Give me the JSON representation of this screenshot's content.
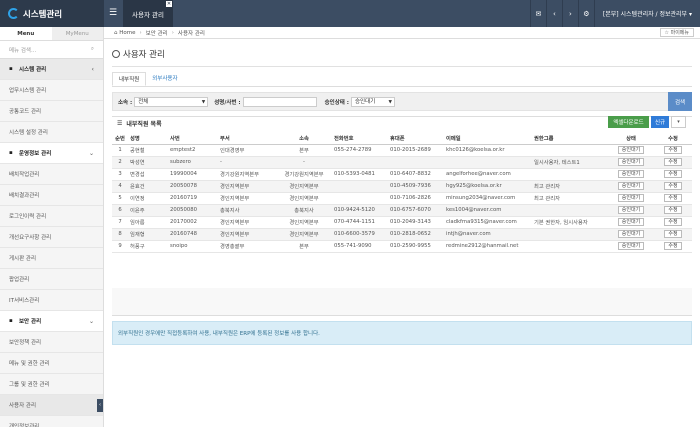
{
  "app": {
    "title": "시스템관리"
  },
  "topbar": {
    "active_tab": "사용자 관리",
    "user_label": "[본부] 시스템관리자 / 정보관리부 ▾"
  },
  "sidebar": {
    "tabs": [
      "Menu",
      "MyMenu"
    ],
    "search_placeholder": "메뉴 검색...",
    "items": [
      {
        "label": "시스템 관리",
        "type": "group"
      },
      {
        "label": "업무시스템 관리",
        "type": "item"
      },
      {
        "label": "공통코드 관리",
        "type": "item"
      },
      {
        "label": "시스템 설정 관리",
        "type": "item"
      },
      {
        "label": "운영정보 관리",
        "type": "group-open"
      },
      {
        "label": "배치작업관리",
        "type": "item"
      },
      {
        "label": "배치결과관리",
        "type": "item"
      },
      {
        "label": "로그인이력 관리",
        "type": "item"
      },
      {
        "label": "개선요구사항 관리",
        "type": "item"
      },
      {
        "label": "게시판 관리",
        "type": "item"
      },
      {
        "label": "팝업관리",
        "type": "item"
      },
      {
        "label": "IT서비스관리",
        "type": "item"
      },
      {
        "label": "보안 관리",
        "type": "group-open"
      },
      {
        "label": "보안정책 관리",
        "type": "item"
      },
      {
        "label": "메뉴 및 권한 관리",
        "type": "item"
      },
      {
        "label": "그룹 및 권한 관리",
        "type": "item"
      },
      {
        "label": "사용자 관리",
        "type": "active"
      },
      {
        "label": "개인정보관리",
        "type": "item"
      }
    ]
  },
  "breadcrumb": {
    "home": "Home",
    "level1": "보안 관리",
    "level2": "사용자 관리",
    "favorite": "☆ 마이메뉴"
  },
  "page": {
    "title": "사용자 관리",
    "tabs": [
      "내부직원",
      "외부사용자"
    ]
  },
  "filter": {
    "org_label": "소속 :",
    "org_value": "전체",
    "name_label": "성명/사번 :",
    "status_label": "승인상태 :",
    "status_value": "승인대기",
    "search_button": "검색"
  },
  "list": {
    "title": "내부직원 목록",
    "excel_button": "엑셀다운로드",
    "new_button": "신규",
    "columns": [
      "순번",
      "성명",
      "사번",
      "부서",
      "소속",
      "전화번호",
      "휴대폰",
      "이메일",
      "권한그룹",
      "상태",
      "수정"
    ],
    "rows": [
      [
        "1",
        "공현철",
        "emptest2",
        "인대경영부",
        "본부",
        "055-274-2789",
        "010-2015-2689",
        "khc0126@koelsa.or.kr",
        "",
        "승인대기",
        "수정"
      ],
      [
        "2",
        "박성연",
        "subzero",
        "-",
        "-",
        "",
        "",
        "",
        "일시사용자, 테스트1",
        "승인대기",
        "수정"
      ],
      [
        "3",
        "변경섭",
        "19990004",
        "경기강원지역본부",
        "경기강원지역본부",
        "010-5393-0481",
        "010-6407-8832",
        "angelforhee@naver.com",
        "",
        "승인대기",
        "수정"
      ],
      [
        "4",
        "윤효건",
        "20050078",
        "경인지역본부",
        "경인지역본부",
        "",
        "010-4509-7936",
        "hgy925@koelsa.or.kr",
        "최고 관리자",
        "승인대기",
        "수정"
      ],
      [
        "5",
        "이연정",
        "20160719",
        "경인지역본부",
        "경인지역본부",
        "",
        "010-7106-2826",
        "minsung2034@naver.com",
        "최고 관리자",
        "승인대기",
        "수정"
      ],
      [
        "6",
        "이윤주",
        "20050080",
        "총북지사",
        "총북지사",
        "010-9424-5120",
        "010-6757-6070",
        "kes1004@naver.com",
        "",
        "승인대기",
        "수정"
      ],
      [
        "7",
        "임아름",
        "20170002",
        "경인지역본부",
        "경인지역본부",
        "070-4744-1151",
        "010-2049-3143",
        "cladkfma9315@naver.com",
        "기본 권한자, 임시사용자",
        "승인대기",
        "수정"
      ],
      [
        "8",
        "임재형",
        "20160748",
        "경인지역본부",
        "경인지역본부",
        "010-6600-3579",
        "010-2818-0652",
        "intjh@naver.com",
        "",
        "승인대기",
        "수정"
      ],
      [
        "9",
        "허풍구",
        "snoipo",
        "경영총괄부",
        "본부",
        "055-741-9090",
        "010-2590-9955",
        "redmine2912@hanmail.net",
        "",
        "승인대기",
        "수정"
      ]
    ]
  },
  "note": "외부직원인 경우에만 직접등록하여 사용, 내부직원은 ERP에 등록된 정보를 사용 합니다."
}
